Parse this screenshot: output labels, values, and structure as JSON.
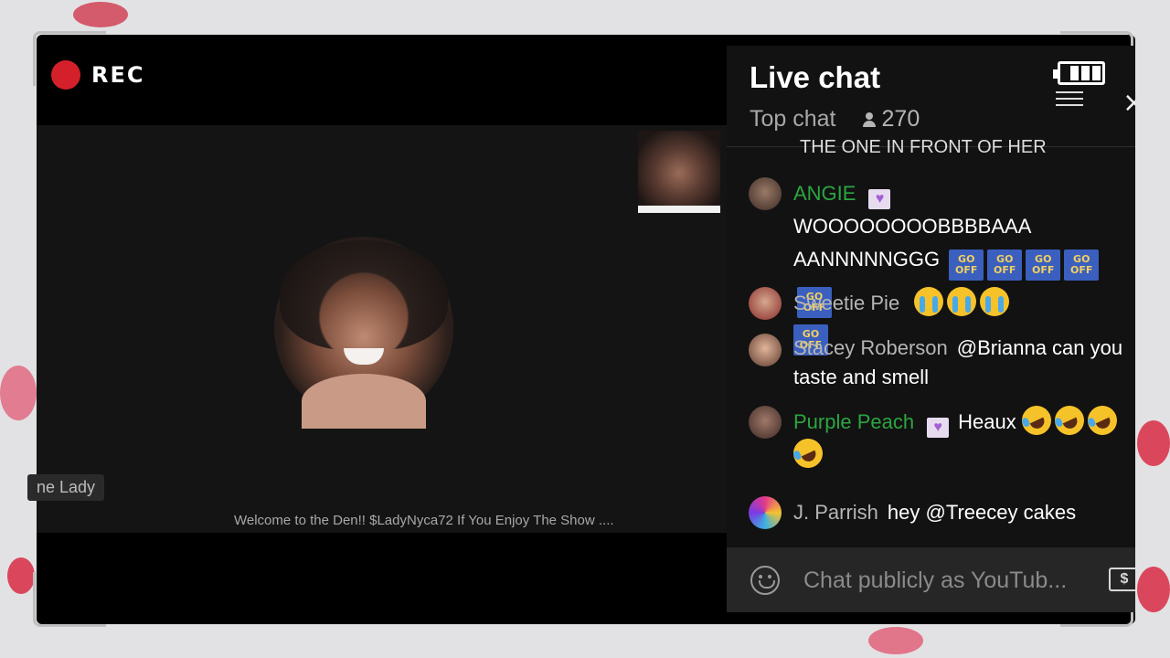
{
  "recording": {
    "label": "REC",
    "dot_color": "#d4202a"
  },
  "video": {
    "name_tag": "ne Lady",
    "ticker": "Welcome to the Den!! $LadyNyca72 If You Enjoy The Show ...."
  },
  "chat": {
    "title": "Live chat",
    "mode": "Top chat",
    "viewer_count": "270",
    "cut_off_message": "THE ONE IN FRONT OF HER",
    "messages": [
      {
        "author": "ANGIE",
        "member": true,
        "text": "WOOOOOOOOBBBBAAA AANNNNNGGG",
        "badge": "purple-heart",
        "emotes": [
          "GO OFF",
          "GO OFF",
          "GO OFF",
          "GO OFF",
          "GO OFF",
          "GO OFF"
        ]
      },
      {
        "author": "Sweetie Pie",
        "member": false,
        "text": "",
        "emojis": [
          "loudly-crying-face",
          "loudly-crying-face",
          "loudly-crying-face"
        ]
      },
      {
        "author": "Stacey Roberson",
        "member": false,
        "text": "@Brianna can you taste and smell"
      },
      {
        "author": "Purple Peach",
        "member": true,
        "text": "Heaux",
        "badge": "purple-heart",
        "emojis": [
          "rolling-on-floor-laughing",
          "rolling-on-floor-laughing",
          "rolling-on-floor-laughing",
          "rolling-on-floor-laughing"
        ]
      },
      {
        "author": "J. Parrish",
        "member": false,
        "text": "hey @Treecey cakes"
      }
    ],
    "composer_placeholder": "Chat publicly as YouTub...",
    "member_color": "#2ba640"
  },
  "emote_label": {
    "line1": "GO",
    "line2": "OFF"
  },
  "emote_label_raw": "GO OFF"
}
